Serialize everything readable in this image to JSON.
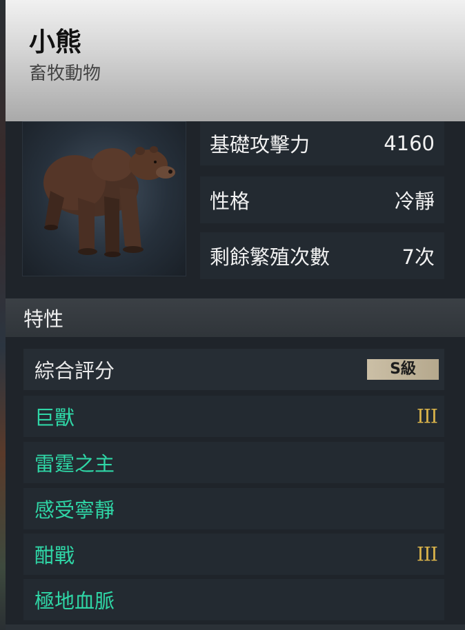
{
  "header": {
    "title": "小熊",
    "subtitle": "畜牧動物"
  },
  "portrait": {
    "icon": "bear-portrait"
  },
  "stats": [
    {
      "label": "基礎攻擊力",
      "value": "4160"
    },
    {
      "label": "性格",
      "value": "冷靜"
    },
    {
      "label": "剩餘繁殖次數",
      "value": "7次"
    }
  ],
  "traits": {
    "title": "特性",
    "overall": {
      "label": "綜合評分",
      "grade": "S級"
    },
    "items": [
      {
        "name": "巨獸",
        "rank": "III"
      },
      {
        "name": "雷霆之主",
        "rank": ""
      },
      {
        "name": "感受寧靜",
        "rank": ""
      },
      {
        "name": "酣戰",
        "rank": "III"
      },
      {
        "name": "極地血脈",
        "rank": ""
      }
    ]
  },
  "colors": {
    "trait_text": "#2fd6a6",
    "rank_gold": "#d8b24a",
    "grade_badge": "#cbbfa6"
  }
}
